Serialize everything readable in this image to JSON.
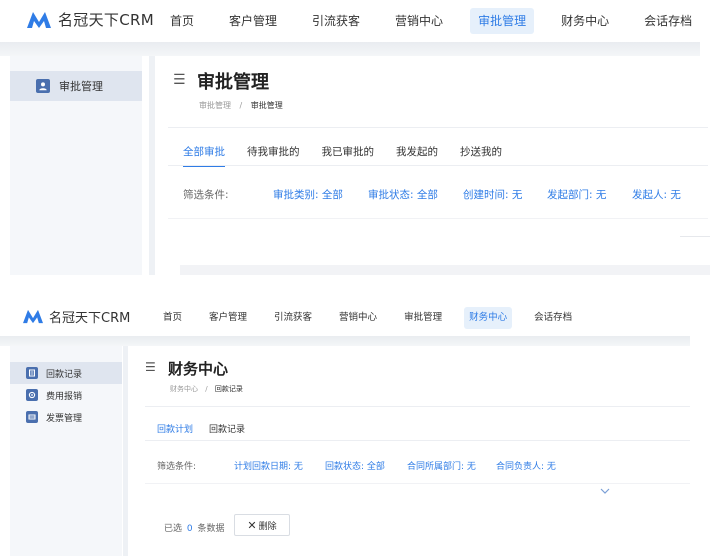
{
  "brand": {
    "name": "名冠天下CRM",
    "logo_color": "#2f7ce6"
  },
  "colors": {
    "accent": "#2f7ce6",
    "active_bg": "#e6f0fb",
    "sidebar_active": "#dfe5ef",
    "icon_blue": "#4a6fae"
  },
  "panel1": {
    "nav": [
      "首页",
      "客户管理",
      "引流获客",
      "营销中心",
      "审批管理",
      "财务中心",
      "会话存档"
    ],
    "nav_active": "审批管理",
    "sidebar": [
      {
        "label": "审批管理",
        "icon": "user-icon"
      }
    ],
    "page_title": "审批管理",
    "breadcrumb": {
      "root": "审批管理",
      "sep": "/",
      "current": "审批管理"
    },
    "tabs": [
      "全部审批",
      "待我审批的",
      "我已审批的",
      "我发起的",
      "抄送我的"
    ],
    "filter_label": "筛选条件:",
    "filters": [
      "审批类别: 全部",
      "审批状态: 全部",
      "创建时间: 无",
      "发起部门: 无",
      "发起人: 无"
    ]
  },
  "panel2": {
    "nav": [
      "首页",
      "客户管理",
      "引流获客",
      "营销中心",
      "审批管理",
      "财务中心",
      "会话存档"
    ],
    "nav_active": "财务中心",
    "sidebar": [
      {
        "label": "回款记录",
        "icon": "document-icon"
      },
      {
        "label": "费用报销",
        "icon": "gear-icon"
      },
      {
        "label": "发票管理",
        "icon": "invoice-icon"
      }
    ],
    "page_title": "财务中心",
    "breadcrumb": {
      "root": "财务中心",
      "sep": "/",
      "current": "回款记录"
    },
    "tabs": [
      "回款计划",
      "回款记录"
    ],
    "filter_label": "筛选条件:",
    "filters": [
      "计划回款日期: 无",
      "回款状态: 全部",
      "合同所属部门: 无",
      "合同负责人: 无"
    ],
    "selected": {
      "prefix": "已选",
      "count": "0",
      "suffix": "条数据"
    },
    "delete_label": "删除"
  }
}
